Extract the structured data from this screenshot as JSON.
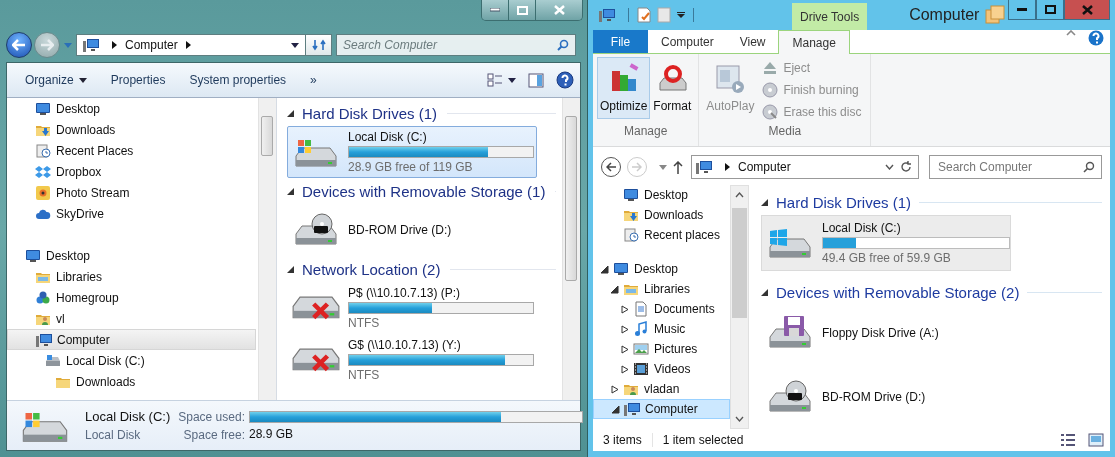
{
  "left_window": {
    "address": {
      "path": "Computer"
    },
    "search": {
      "placeholder": "Search Computer"
    },
    "toolbar": [
      {
        "label": "Organize",
        "dropdown": true
      },
      {
        "label": "Properties",
        "dropdown": false
      },
      {
        "label": "System properties",
        "dropdown": false
      },
      {
        "label": "»",
        "dropdown": false
      }
    ],
    "favorites": [
      {
        "kind": "desktop",
        "label": "Desktop",
        "selected": false
      },
      {
        "kind": "downloads",
        "label": "Downloads",
        "selected": false
      },
      {
        "kind": "recent",
        "label": "Recent Places",
        "selected": false
      },
      {
        "kind": "dropbox",
        "label": "Dropbox",
        "selected": false
      },
      {
        "kind": "photos",
        "label": "Photo Stream",
        "selected": false
      },
      {
        "kind": "skydrive",
        "label": "SkyDrive",
        "selected": false
      }
    ],
    "tree": [
      {
        "kind": "desktop",
        "label": "Desktop",
        "selected": false,
        "children": [
          {
            "kind": "libraries",
            "label": "Libraries",
            "selected": false
          },
          {
            "kind": "homegroup",
            "label": "Homegroup",
            "selected": false
          },
          {
            "kind": "user",
            "label": "vl",
            "selected": false
          },
          {
            "kind": "computer",
            "label": "Computer",
            "selected": true,
            "children": [
              {
                "kind": "drive",
                "label": "Local Disk (C:)",
                "selected": false,
                "children": [
                  {
                    "kind": "folder",
                    "label": "Downloads",
                    "selected": false
                  }
                ]
              }
            ]
          }
        ]
      }
    ],
    "sections": [
      {
        "title": "Hard Disk Drives (1)",
        "expanded": true,
        "items": [
          {
            "kind": "disk",
            "name": "Local Disk (C:)",
            "level": 0.757,
            "reading": "28.9 GB free of 119 GB",
            "selected": true
          }
        ]
      },
      {
        "title": "Devices with Removable Storage (1)",
        "expanded": true,
        "items": [
          {
            "kind": "bd",
            "name": "BD-ROM Drive (D:)",
            "selected": false
          }
        ]
      },
      {
        "title": "Network Location (2)",
        "expanded": true,
        "items": [
          {
            "kind": "network",
            "name": "P$ (\\\\10.10.7.13) (P:)",
            "level": 0.45,
            "reading": "NTFS",
            "selected": false
          },
          {
            "kind": "network",
            "name": "G$ (\\\\10.10.7.13) (Y:)",
            "level": 0.85,
            "reading": "NTFS",
            "selected": false
          }
        ]
      }
    ],
    "details": {
      "name": "Local Disk (C:)",
      "type": "Local Disk",
      "used_label": "Space used:",
      "level": 0.757,
      "free_label": "Space free:",
      "free_value": "28.9 GB"
    }
  },
  "right_window": {
    "title": "Computer",
    "context_tab": "Drive Tools",
    "tabs": [
      {
        "label": "File",
        "kind": "file",
        "selected": false
      },
      {
        "label": "Computer",
        "kind": "tab",
        "selected": false
      },
      {
        "label": "View",
        "kind": "tab",
        "selected": false
      },
      {
        "label": "Manage",
        "kind": "tab",
        "selected": true
      }
    ],
    "ribbon_groups": [
      {
        "label": "Manage",
        "commands": [
          {
            "kind": "optimize",
            "label": "Optimize",
            "selected": true,
            "disabled": false
          },
          {
            "kind": "format",
            "label": "Format",
            "selected": false,
            "disabled": false
          }
        ]
      },
      {
        "label": "Media",
        "commands": [
          {
            "kind": "autoplay",
            "label": "AutoPlay",
            "selected": false,
            "disabled": true
          },
          {
            "kind": "eject",
            "label": "Eject",
            "selected": false,
            "disabled": true
          },
          {
            "kind": "burn",
            "label": "Finish burning",
            "selected": false,
            "disabled": true
          },
          {
            "kind": "erase",
            "label": "Erase this disc",
            "selected": false,
            "disabled": true
          }
        ]
      }
    ],
    "address": {
      "path": "Computer"
    },
    "search": {
      "placeholder": "Search Computer"
    },
    "favorites": [
      {
        "kind": "desktop",
        "label": "Desktop",
        "selected": false
      },
      {
        "kind": "downloads",
        "label": "Downloads",
        "selected": false
      },
      {
        "kind": "recent",
        "label": "Recent places",
        "selected": false
      }
    ],
    "tree": [
      {
        "kind": "desktop",
        "label": "Desktop",
        "expanded": true,
        "selected": false,
        "children": [
          {
            "kind": "libraries",
            "label": "Libraries",
            "expanded": true,
            "selected": false,
            "children": [
              {
                "kind": "documents",
                "label": "Documents",
                "expanded": false,
                "selected": false
              },
              {
                "kind": "music",
                "label": "Music",
                "expanded": false,
                "selected": false
              },
              {
                "kind": "pictures",
                "label": "Pictures",
                "expanded": false,
                "selected": false
              },
              {
                "kind": "videos",
                "label": "Videos",
                "expanded": false,
                "selected": false
              }
            ]
          },
          {
            "kind": "user",
            "label": "vladan",
            "expanded": false,
            "selected": false
          },
          {
            "kind": "computer",
            "label": "Computer",
            "expanded": true,
            "selected": true
          }
        ]
      }
    ],
    "sections": [
      {
        "title": "Hard Disk Drives (1)",
        "expanded": true,
        "items": [
          {
            "kind": "disk8",
            "name": "Local Disk (C:)",
            "level": 0.175,
            "reading": "49.4 GB free of 59.9 GB",
            "selected": true
          }
        ]
      },
      {
        "title": "Devices with Removable Storage (2)",
        "expanded": true,
        "items": [
          {
            "kind": "floppy",
            "name": "Floppy Disk Drive (A:)",
            "selected": false
          },
          {
            "kind": "bd",
            "name": "BD-ROM Drive (D:)",
            "selected": false
          }
        ]
      }
    ],
    "status": {
      "count": "3 items",
      "selection": "1 item selected"
    }
  }
}
